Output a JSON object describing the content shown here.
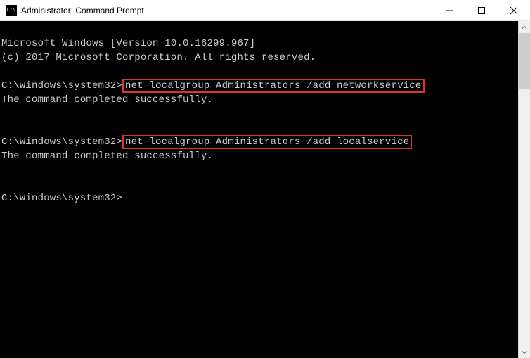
{
  "window": {
    "title": "Administrator: Command Prompt"
  },
  "terminal": {
    "line1": "Microsoft Windows [Version 10.0.16299.967]",
    "line2": "(c) 2017 Microsoft Corporation. All rights reserved.",
    "prompt1_prefix": "C:\\Windows\\system32>",
    "cmd1": "net localgroup Administrators /add networkservice",
    "result1": "The command completed successfully.",
    "prompt2_prefix": "C:\\Windows\\system32>",
    "cmd2": "net localgroup Administrators /add localservice",
    "result2": "The command completed successfully.",
    "prompt3": "C:\\Windows\\system32>"
  }
}
